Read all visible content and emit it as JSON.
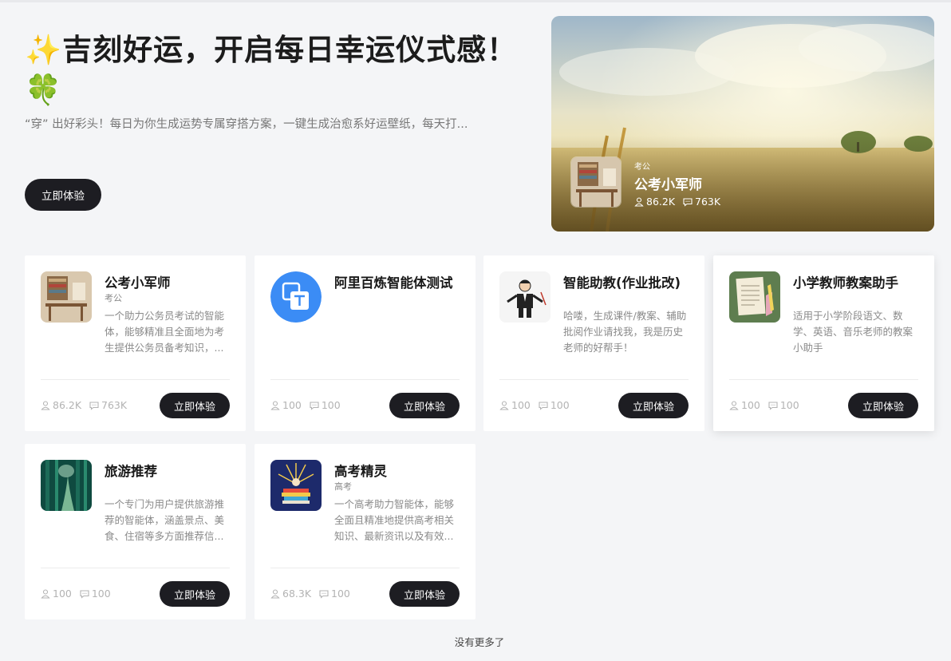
{
  "hero": {
    "title": "✨吉刻好运，开启每日幸运仪式感！ 🍀",
    "description": "“穿” 出好彩头！每日为你生成运势专属穿搭方案，一键生成治愈系好运壁纸，每天打...",
    "cta_label": "立即体验",
    "banner": {
      "tag": "考公",
      "name": "公考小军师",
      "users": "86.2K",
      "messages": "763K"
    }
  },
  "cards": [
    {
      "title": "公考小军师",
      "tag": "考公",
      "description": "一个助力公务员考试的智能体，能够精准且全面地为考生提供公务员备考知识，...",
      "users": "86.2K",
      "messages": "763K",
      "button": "立即体验",
      "icon": "study-desk-image"
    },
    {
      "title": "阿里百炼智能体测试",
      "tag": "",
      "description": "",
      "users": "100",
      "messages": "100",
      "button": "立即体验",
      "icon": "text-translate-icon"
    },
    {
      "title": "智能助教(作业批改)",
      "tag": "",
      "description": "哈喽，生成课件/教案、辅助批阅作业请找我，我是历史老师的好帮手！",
      "users": "100",
      "messages": "100",
      "button": "立即体验",
      "icon": "teacher-cartoon-image"
    },
    {
      "title": "小学教师教案助手",
      "tag": "",
      "description": "适用于小学阶段语文、数学、英语、音乐老师的教案小助手",
      "users": "100",
      "messages": "100",
      "button": "立即体验",
      "icon": "lesson-plan-paper-image"
    },
    {
      "title": "旅游推荐",
      "tag": "",
      "description": "一个专门为用户提供旅游推荐的智能体，涵盖景点、美食、住宿等多方面推荐信...",
      "users": "100",
      "messages": "100",
      "button": "立即体验",
      "icon": "forest-path-image"
    },
    {
      "title": "高考精灵",
      "tag": "高考",
      "description": "一个高考助力智能体，能够全面且精准地提供高考相关知识、最新资讯以及有效...",
      "users": "68.3K",
      "messages": "100",
      "button": "立即体验",
      "icon": "books-celebration-image"
    }
  ],
  "footer": {
    "no_more": "没有更多了"
  },
  "colors": {
    "button_bg": "#1d1d22",
    "page_bg": "#f4f5f7",
    "muted_text": "#8a8a8a"
  }
}
